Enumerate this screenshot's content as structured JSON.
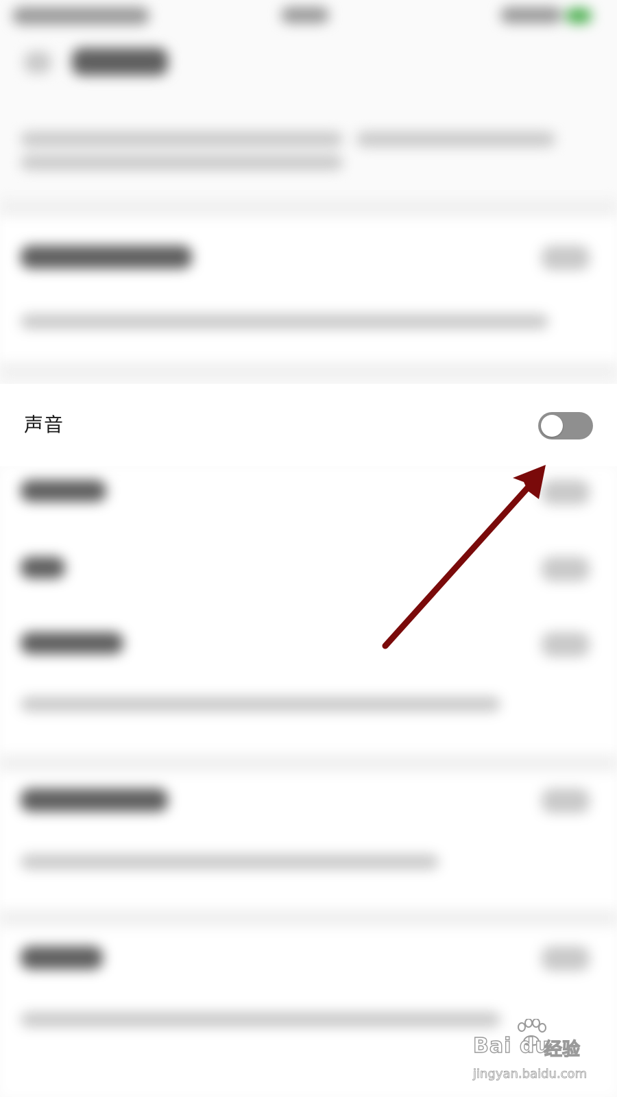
{
  "sound_row": {
    "label": "声音",
    "toggle_on": false
  },
  "toggle_colors": {
    "track_off": "#8f8f8f",
    "knob": "#ffffff"
  },
  "annotation": {
    "arrow_color": "#7a0a0a"
  },
  "watermark": {
    "brand": "Bai du",
    "product": "经验",
    "url": "jingyan.baidu.com"
  }
}
